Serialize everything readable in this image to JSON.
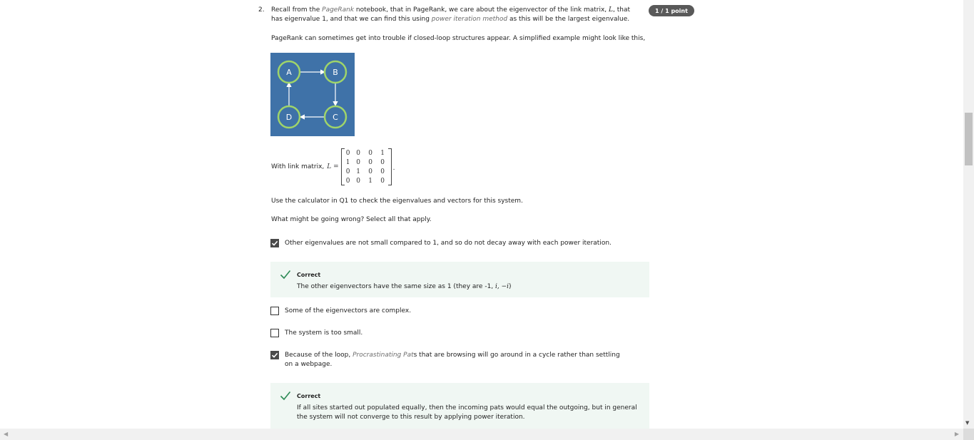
{
  "question": {
    "number": "2.",
    "intro_a": "Recall from the ",
    "intro_em": "PageRank",
    "intro_b": " notebook, that in PageRank, we care about the eigenvector of the link matrix, ",
    "intro_math": "L",
    "intro_c": ", that has eigenvalue 1, and that we can find this using ",
    "intro_em2": "power iteration method",
    "intro_d": " as this will be the largest eigenvalue.",
    "para2": "PageRank can sometimes get into trouble if closed-loop structures appear. A simplified example might look like this,",
    "score_badge": "1 / 1 point",
    "diagram": {
      "bg_color": "#3f72a8",
      "node_stroke": "#9fd46a",
      "nodes": [
        "A",
        "B",
        "C",
        "D"
      ]
    },
    "matrix_label": "With link matrix, ",
    "matrix_symbol": "L =",
    "matrix_rows": [
      [
        "0",
        "0",
        "0",
        "1"
      ],
      [
        "1",
        "0",
        "0",
        "0"
      ],
      [
        "0",
        "1",
        "0",
        "0"
      ],
      [
        "0",
        "0",
        "1",
        "0"
      ]
    ],
    "matrix_end": ".",
    "para3": "Use the calculator in Q1 to check the eigenvalues and vectors for this system.",
    "para4": "What might be going wrong? Select all that apply."
  },
  "options": [
    {
      "text": "Other eigenvalues are not small compared to 1, and so do not decay away with each power iteration.",
      "checked": true
    },
    {
      "text": "Some of the eigenvectors are complex.",
      "checked": false
    },
    {
      "text": "The system is too small.",
      "checked": false
    },
    {
      "text_a": "Because of the loop, ",
      "text_em": "Procrastinating Pat",
      "text_b": "s that are browsing will go around in a cycle rather than settling on a webpage.",
      "checked": true
    }
  ],
  "feedback": [
    {
      "title": "Correct",
      "text": "The other eigenvectors have the same size as 1 (they are -1, ",
      "math": "i, −i",
      "text_end": ")"
    },
    {
      "title": "Correct",
      "text": "If all sites started out populated equally, then the incoming pats would equal the outgoing, but in general the system will not converge to this result by applying power iteration."
    }
  ],
  "colors": {
    "feedback_bg": "#f0f7f3",
    "check_green": "#2e8b57",
    "badge_bg": "#595959"
  }
}
